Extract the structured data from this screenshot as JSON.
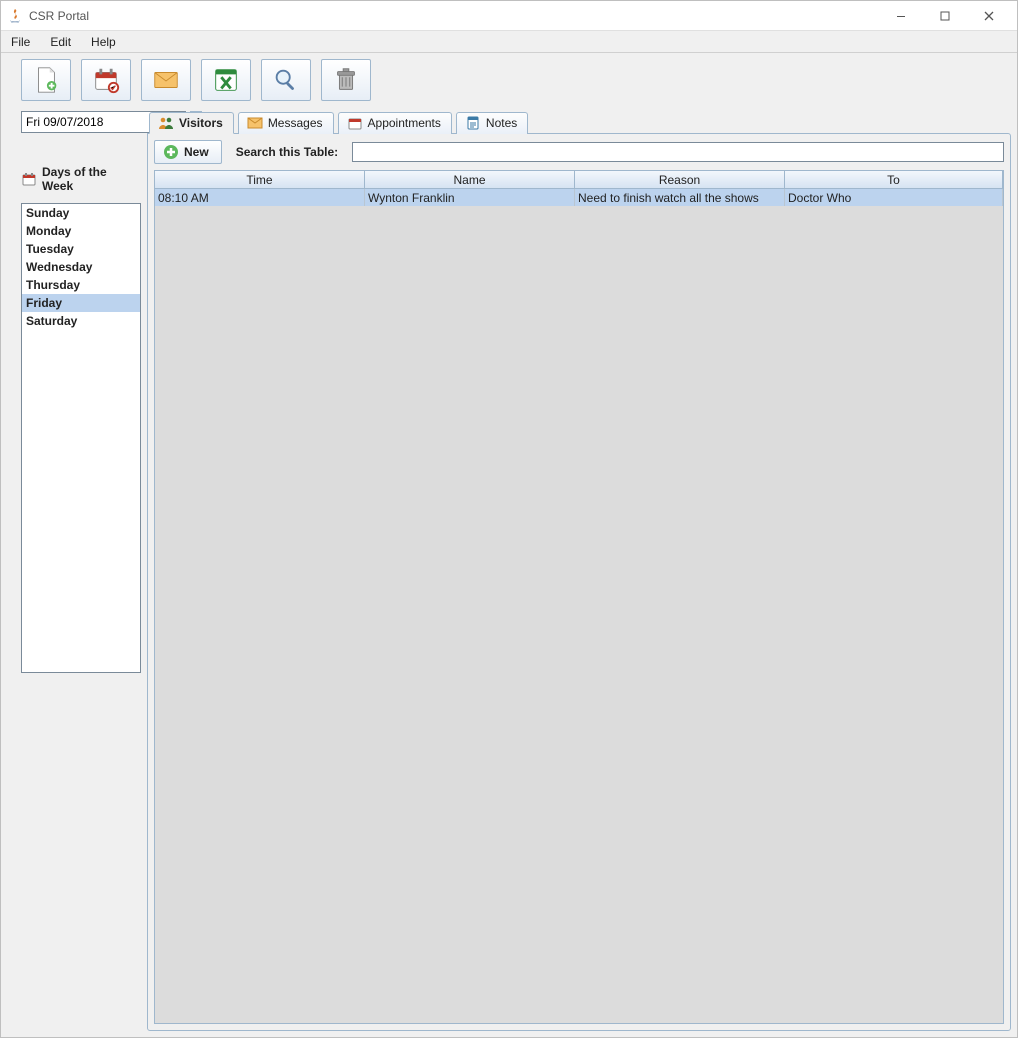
{
  "window": {
    "title": "CSR Portal"
  },
  "menu": {
    "file": "File",
    "edit": "Edit",
    "help": "Help"
  },
  "sidebar": {
    "date_value": "Fri 09/07/2018",
    "days_header": "Days of the Week",
    "days": [
      "Sunday",
      "Monday",
      "Tuesday",
      "Wednesday",
      "Thursday",
      "Friday",
      "Saturday"
    ],
    "selected_day_index": 5
  },
  "tabs": {
    "visitors": "Visitors",
    "messages": "Messages",
    "appointments": "Appointments",
    "notes": "Notes",
    "active": "visitors"
  },
  "panel": {
    "new_label": "New",
    "search_label": "Search this Table:",
    "search_value": ""
  },
  "table": {
    "columns": {
      "time": "Time",
      "name": "Name",
      "reason": "Reason",
      "to": "To"
    },
    "rows": [
      {
        "time": "08:10 AM",
        "name": "Wynton Franklin",
        "reason": "Need to finish watch all the shows",
        "to": "Doctor Who"
      }
    ],
    "selected_row_index": 0
  }
}
